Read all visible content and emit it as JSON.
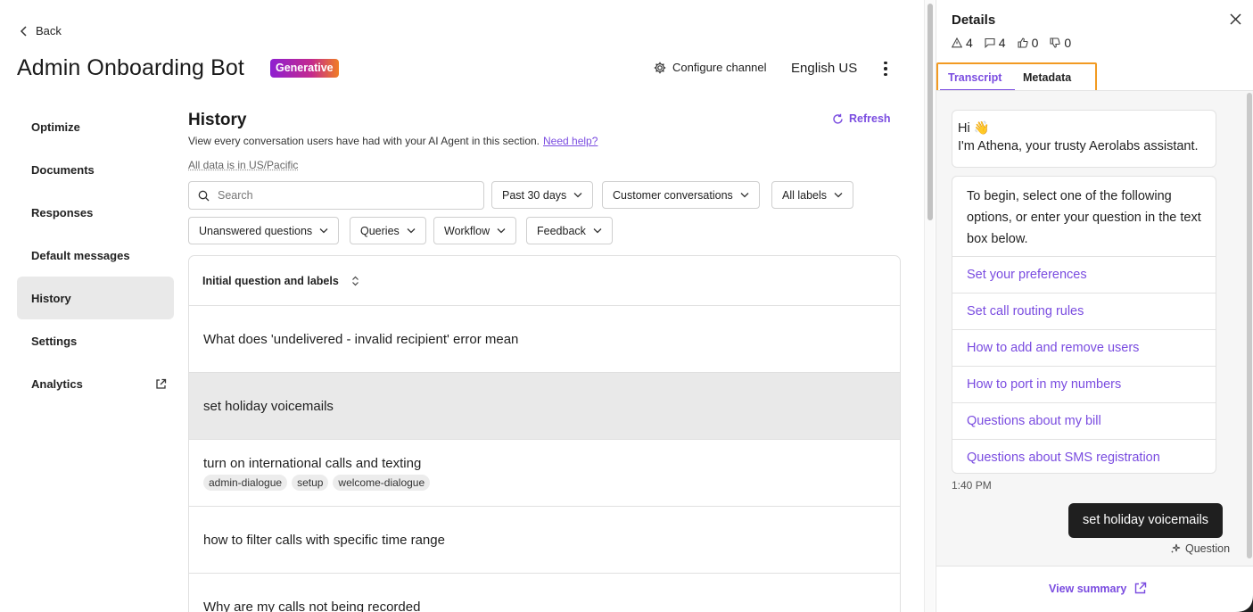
{
  "header": {
    "back_label": "Back",
    "title": "Admin Onboarding Bot",
    "badge": "Generative",
    "configure_label": "Configure channel",
    "language": "English US"
  },
  "sidebar": {
    "items": [
      {
        "label": "Optimize"
      },
      {
        "label": "Documents"
      },
      {
        "label": "Responses"
      },
      {
        "label": "Default messages"
      },
      {
        "label": "History",
        "active": true
      },
      {
        "label": "Settings"
      },
      {
        "label": "Analytics",
        "icon": "external-link-icon"
      }
    ]
  },
  "history": {
    "title": "History",
    "description": "View every conversation users have had with your AI Agent in this section.",
    "help_link": "Need help?",
    "timezone_note": "All data is in US/Pacific",
    "refresh_label": "Refresh",
    "search_placeholder": "Search",
    "filters": {
      "date": "Past 30 days",
      "conversation_type": "Customer conversations",
      "labels": "All labels",
      "unanswered": "Unanswered questions",
      "queries": "Queries",
      "workflow": "Workflow",
      "feedback": "Feedback"
    },
    "table": {
      "column_header": "Initial question and labels",
      "rows": [
        {
          "question": "What does 'undelivered - invalid recipient' error mean",
          "tags": []
        },
        {
          "question": "set holiday voicemails",
          "tags": [],
          "selected": true
        },
        {
          "question": "turn on international calls and texting",
          "tags": [
            "admin-dialogue",
            "setup",
            "welcome-dialogue"
          ]
        },
        {
          "question": "how to filter calls with specific time range",
          "tags": []
        },
        {
          "question": "Why are my calls not being recorded",
          "tags": []
        }
      ]
    }
  },
  "details": {
    "title": "Details",
    "stats": {
      "warnings": "4",
      "comments": "4",
      "thumbs_up": "0",
      "thumbs_down": "0"
    },
    "tabs": [
      {
        "label": "Transcript",
        "active": true
      },
      {
        "label": "Metadata"
      }
    ],
    "transcript": {
      "greeting_line1": "Hi 👋",
      "greeting_line2": "I'm Athena, your trusty Aerolabs assistant.",
      "intro": "To begin, select one of the following options, or enter your question in the text box below.",
      "options": [
        "Set your preferences",
        "Set call routing rules",
        "How to add and remove users",
        "How to port in my numbers",
        "Questions about my bill",
        "Questions about SMS registration"
      ],
      "timestamp": "1:40 PM",
      "user_message": "set holiday voicemails",
      "message_type": "Question"
    },
    "view_summary_label": "View summary"
  },
  "colors": {
    "accent": "#7a4ce0",
    "highlight_border": "#f29a22",
    "selected_row": "#e9e9e9",
    "user_bubble": "#1f1f1f"
  }
}
